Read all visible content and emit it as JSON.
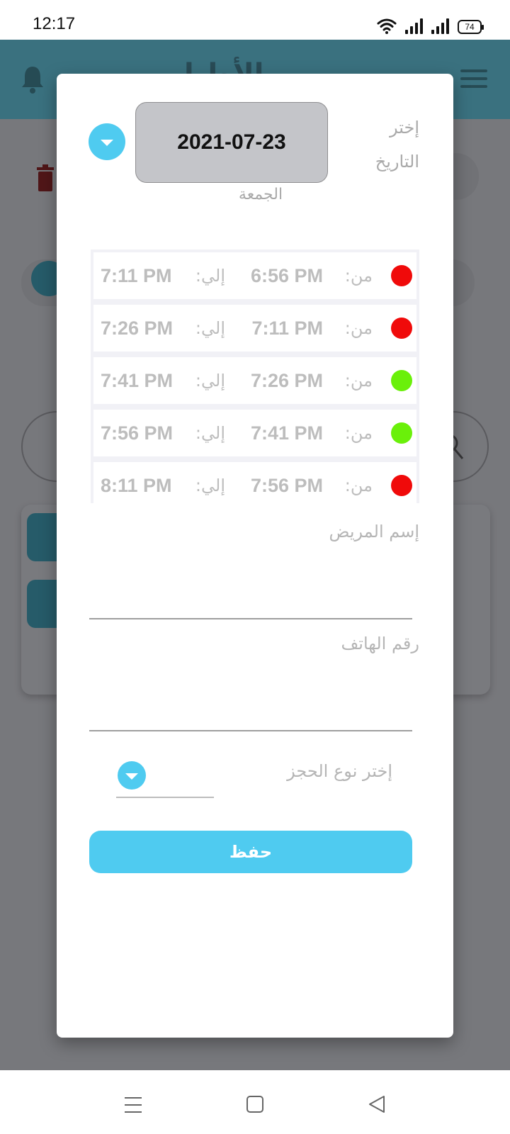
{
  "status_bar": {
    "time": "12:17",
    "battery": "74",
    "icons": [
      "wifi-icon",
      "signal-icon",
      "signal-icon",
      "battery-icon"
    ]
  },
  "background": {
    "header_title": "مـالأطبا"
  },
  "dialog": {
    "date_label": "إختر التاريخ",
    "date_value": "2021-07-23",
    "day_name": "الجمعة",
    "slots": [
      {
        "from_label": "من:",
        "from": "6:56 PM",
        "to_label": "إلي:",
        "to": "7:11 PM",
        "status": "unavailable"
      },
      {
        "from_label": "من:",
        "from": "7:11 PM",
        "to_label": "إلي:",
        "to": "7:26 PM",
        "status": "unavailable"
      },
      {
        "from_label": "من:",
        "from": "7:26 PM",
        "to_label": "إلي:",
        "to": "7:41 PM",
        "status": "available"
      },
      {
        "from_label": "من:",
        "from": "7:41 PM",
        "to_label": "إلي:",
        "to": "7:56 PM",
        "status": "available"
      },
      {
        "from_label": "من:",
        "from": "7:56 PM",
        "to_label": "إلي:",
        "to": "8:11 PM",
        "status": "unavailable"
      }
    ],
    "patient_name_label": "إسم المريض",
    "patient_name_value": "",
    "phone_label": "رقم الهاتف",
    "phone_value": "",
    "booking_type_label": "إختر نوع الحجز",
    "booking_type_value": "",
    "save_label": "حفظ"
  },
  "colors": {
    "accent": "#4fcbf0",
    "header": "#4fb8cf",
    "available": "#6af00a",
    "unavailable": "#f00a0a",
    "overlay": "#6d6e72"
  }
}
